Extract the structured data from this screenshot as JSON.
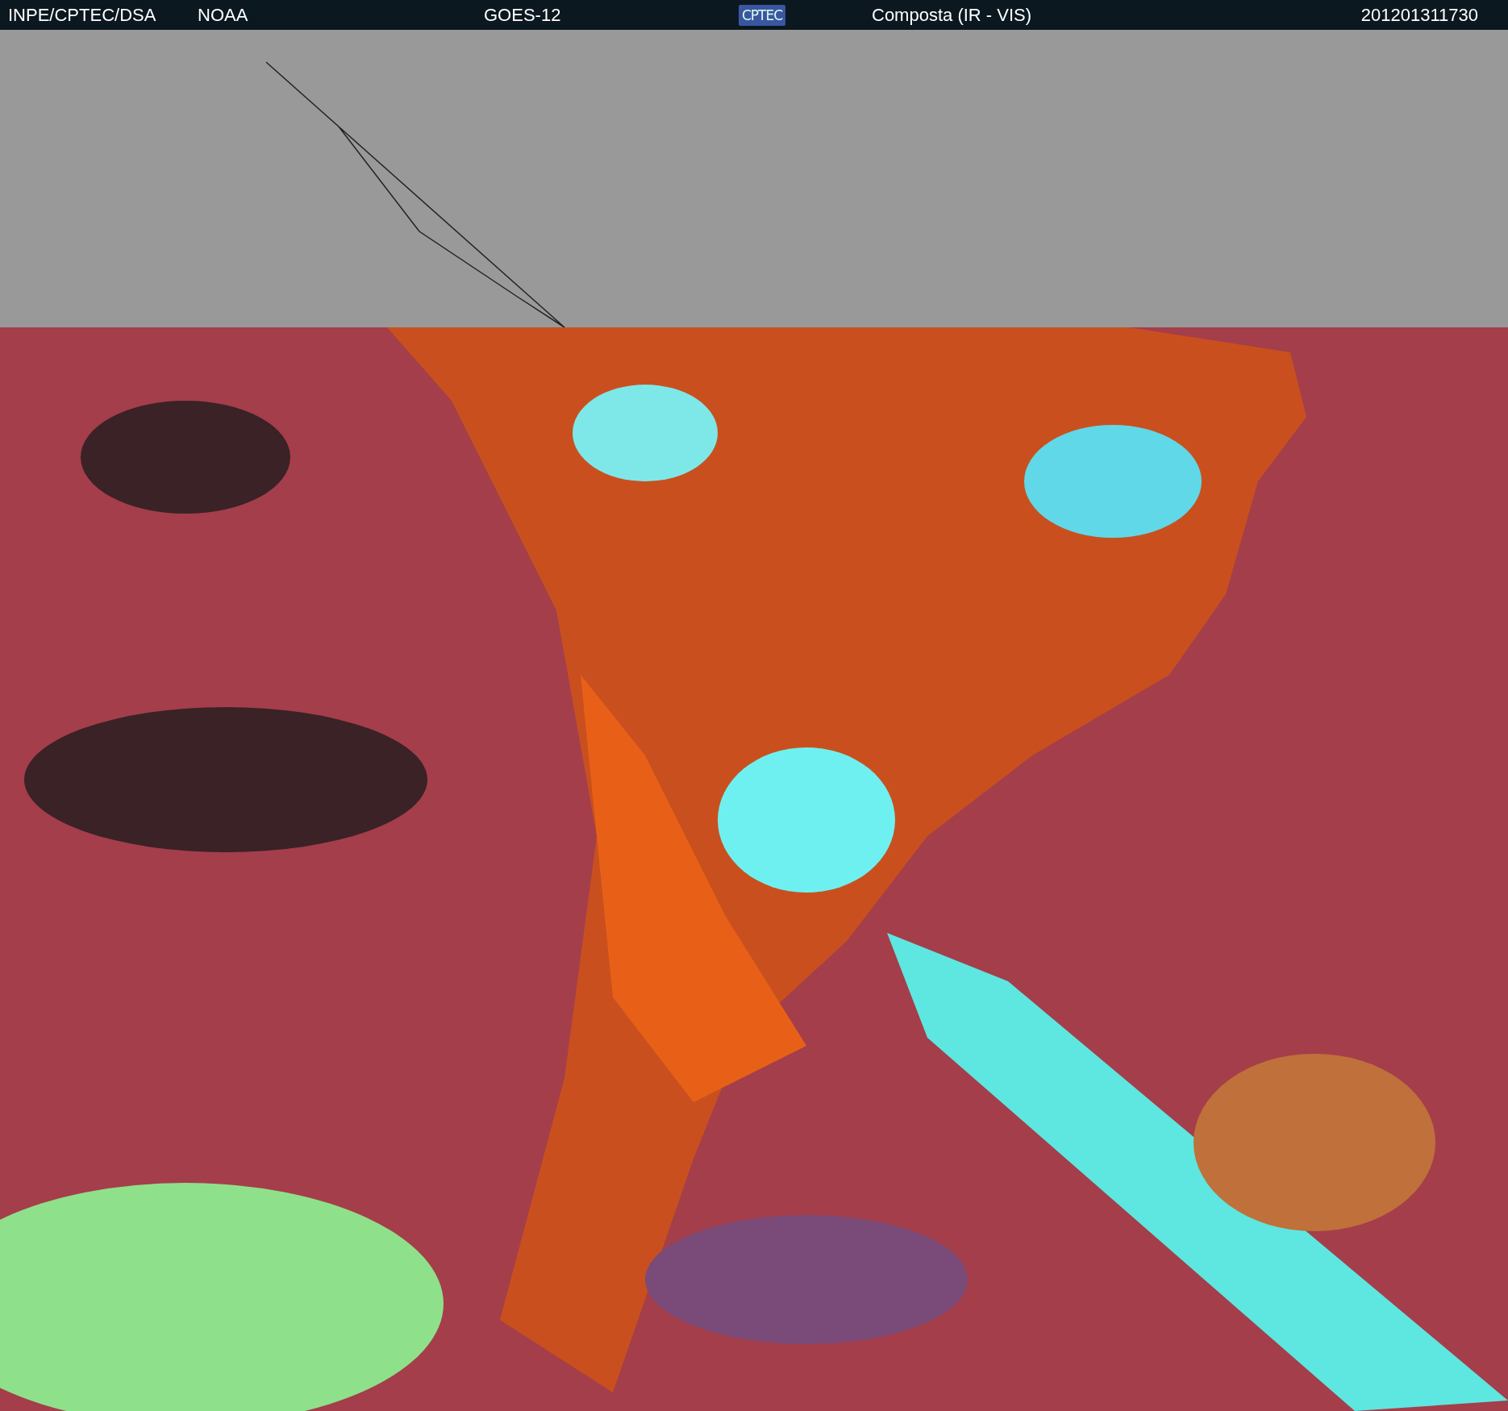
{
  "header": {
    "source": "INPE/CPTEC/DSA",
    "agency": "NOAA",
    "satellite": "GOES-12",
    "logo_text": "CPTEC",
    "product": "Composta (IR - VIS)",
    "timestamp": "201201311730"
  }
}
